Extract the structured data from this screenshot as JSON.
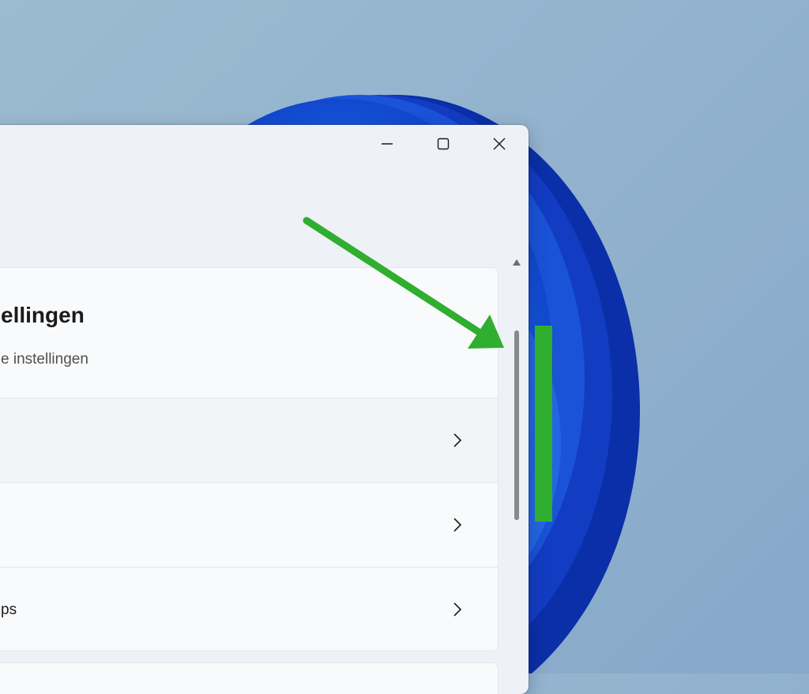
{
  "window": {
    "controls": {
      "minimize_icon": "minimize-icon",
      "maximize_icon": "maximize-icon",
      "close_icon": "close-icon"
    }
  },
  "header": {
    "title": "ellingen",
    "subtitle": "e instellingen"
  },
  "rows": [
    {
      "label": "",
      "icon": "chevron-right-icon"
    },
    {
      "label": "",
      "icon": "chevron-right-icon"
    },
    {
      "label": "ps",
      "icon": "chevron-right-icon"
    }
  ],
  "scrollbar": {
    "up_icon": "scroll-up-icon"
  },
  "annotation": {
    "color": "#2fae2f",
    "arrow_icon": "arrow-icon"
  },
  "colors": {
    "window_bg": "#eef1f6",
    "card_bg": "#f9fafc",
    "bloom": "#1e4fd8"
  }
}
